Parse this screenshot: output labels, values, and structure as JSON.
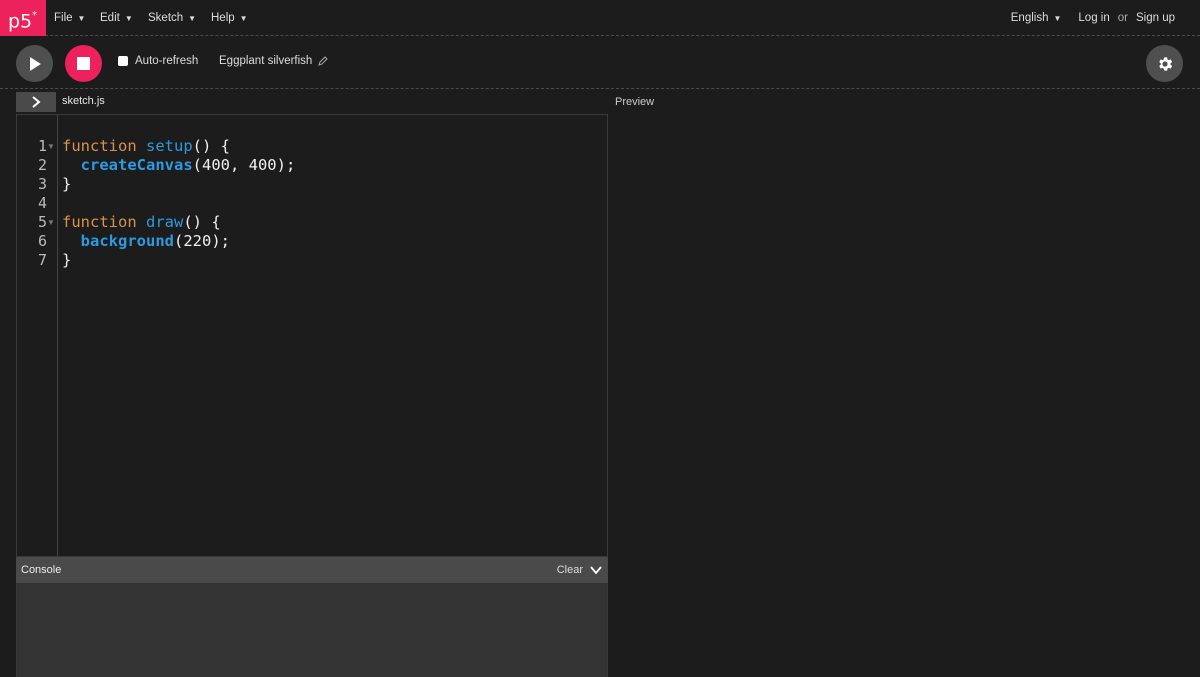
{
  "app": {
    "logo_text": "p5",
    "logo_mark": "*"
  },
  "nav": {
    "menus": [
      {
        "label": "File"
      },
      {
        "label": "Edit"
      },
      {
        "label": "Sketch"
      },
      {
        "label": "Help"
      }
    ],
    "language": "English",
    "login": "Log in",
    "or": "or",
    "signup": "Sign up"
  },
  "toolbar": {
    "auto_refresh_label": "Auto-refresh",
    "auto_refresh_checked": false,
    "sketch_name": "Eggplant silverfish"
  },
  "editor": {
    "file_name": "sketch.js",
    "line_numbers": [
      "1",
      "2",
      "3",
      "4",
      "5",
      "6",
      "7"
    ],
    "lines": [
      "function setup() {",
      "  createCanvas(400, 400);",
      "}",
      "",
      "function draw() {",
      "  background(220);",
      "}"
    ]
  },
  "preview": {
    "label": "Preview"
  },
  "console": {
    "title": "Console",
    "clear_label": "Clear"
  },
  "colors": {
    "accent": "#ed225d",
    "background": "#1c1c1c",
    "keyword": "#d9924c",
    "function_name": "#2d9ae0",
    "button_gray": "#4f4f4f"
  },
  "icons": [
    "play-icon",
    "stop-icon",
    "gear-icon",
    "pencil-icon",
    "chevron-right-icon",
    "chevron-down-icon",
    "caret-down-icon",
    "fold-arrow-icon"
  ]
}
